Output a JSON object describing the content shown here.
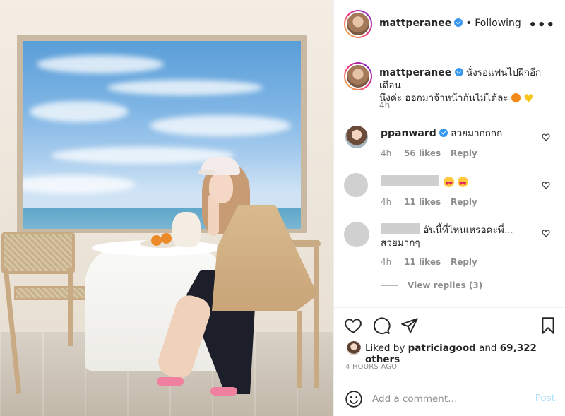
{
  "post": {
    "username": "mattperanee",
    "follow_status": "Following",
    "caption_line1": "นั่งรอแฟนไปฝึกอีกเดือน",
    "caption_line2": "นึงค่ะ ออกมาจ้าหน้ากันไม่ได้ละ",
    "caption_time": "4h"
  },
  "comments": [
    {
      "username": "ppanward",
      "verified": true,
      "text": "สวยมากกกก",
      "time": "4h",
      "likes": "56 likes",
      "reply": "Reply"
    },
    {
      "username": "",
      "text": "",
      "time": "4h",
      "likes": "11 likes",
      "reply": "Reply"
    },
    {
      "username": "",
      "text_line1": "อันนี้ที่ไหนเหรอคะพี่",
      "text_ellipsis": "...",
      "text_line2": "สวยมากๆ",
      "time": "4h",
      "likes": "11 likes",
      "reply": "Reply",
      "view_replies": "View replies (3)"
    }
  ],
  "likes": {
    "prefix": "Liked by",
    "liker": "patriciagood",
    "joiner": "and",
    "others": "69,322 others"
  },
  "timestamp": "4 HOURS AGO",
  "add_comment": {
    "placeholder": "Add a comment…",
    "post_label": "Post"
  },
  "icons": [
    "heart-icon",
    "comment-icon",
    "share-icon",
    "bookmark-icon",
    "emoji-icon",
    "more-icon",
    "verified-icon"
  ],
  "colors": {
    "verified": "#3897f0",
    "post_button": "#b2dffc",
    "meta_text": "#8e8e8e"
  }
}
